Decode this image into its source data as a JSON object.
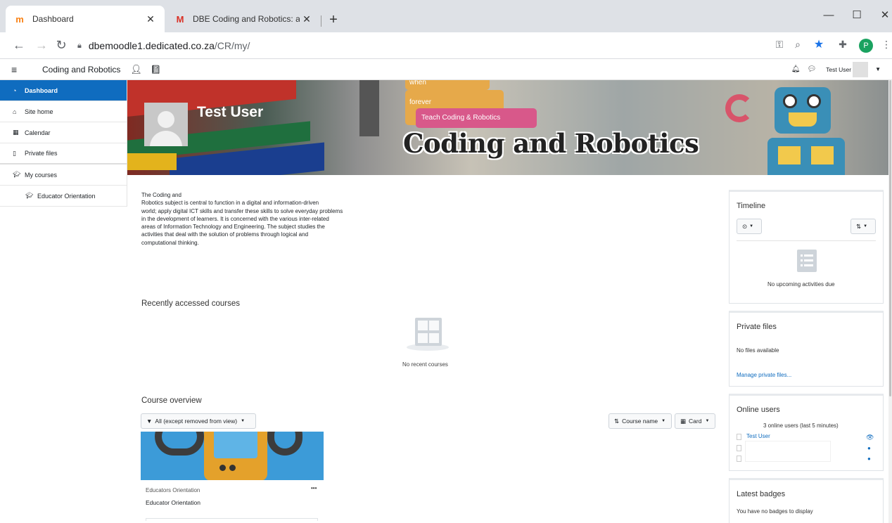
{
  "browser": {
    "tabs": [
      {
        "title": "Dashboard",
        "favicon": "moodle-favicon-icon",
        "active": true
      },
      {
        "title": "DBE Coding and Robotics: accou",
        "favicon": "gmail-favicon-icon",
        "active": false
      }
    ],
    "new_tab": "+",
    "url_host": "dbemoodle1.dedicated.co.za",
    "url_path": "/CR/my/",
    "profile_initial": "P"
  },
  "navbar": {
    "site_name": "Coding and Robotics",
    "user_name": "Test User"
  },
  "drawer": {
    "items": [
      {
        "label": "Dashboard",
        "icon": "dashboard-icon",
        "active": true
      },
      {
        "label": "Site home",
        "icon": "home-icon"
      },
      {
        "label": "Calendar",
        "icon": "calendar-icon"
      },
      {
        "label": "Private files",
        "icon": "file-icon"
      },
      {
        "label": "My courses",
        "icon": "graduation-cap-icon"
      },
      {
        "label": "Educator Orientation",
        "icon": "graduation-cap-icon"
      }
    ]
  },
  "header": {
    "user_fullname": "Test User",
    "banner_title": "Coding and Robotics",
    "banner_block_forever": "forever",
    "banner_block_teach": "Teach Coding & Robotics",
    "banner_block_when": "when"
  },
  "main": {
    "intro_lines": [
      "The Coding and",
      "Robotics subject is central to function in a digital and information-driven",
      "world; apply digital ICT skills and transfer these skills to solve everyday problems",
      "in the development of learners. It is concerned with the various inter-related",
      "areas of Information Technology and Engineering. The subject studies the",
      "activities that deal with the solution of problems through logical and",
      "computational thinking."
    ],
    "recent_title": "Recently accessed courses",
    "recent_empty": "No recent courses",
    "overview_title": "Course overview",
    "filter_label": "All (except removed from view)",
    "sort_label": "Course name",
    "view_label": "Card",
    "course": {
      "category": "Educators Orientation",
      "name": "Educator Orientation",
      "menu": "•••"
    }
  },
  "blocks": {
    "timeline": {
      "title": "Timeline",
      "empty": "No upcoming activities due"
    },
    "private_files": {
      "title": "Private files",
      "empty": "No files available",
      "manage": "Manage private files..."
    },
    "online_users": {
      "title": "Online users",
      "summary": "3 online users (last 5 minutes)",
      "user1": "Test User"
    },
    "badges": {
      "title": "Latest badges",
      "empty": "You have no badges to display"
    }
  },
  "colors": {
    "primary": "#0f6cbf",
    "active_nav": "#0f6cbf"
  }
}
